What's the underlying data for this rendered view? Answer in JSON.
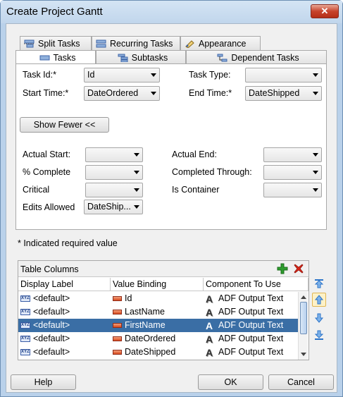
{
  "window": {
    "title": "Create Project Gantt",
    "close_label": "✕"
  },
  "tabs_top": [
    {
      "label": "Split Tasks",
      "icon": "split-tasks-icon"
    },
    {
      "label": "Recurring Tasks",
      "icon": "recurring-tasks-icon"
    },
    {
      "label": "Appearance",
      "icon": "appearance-icon"
    }
  ],
  "tabs_bottom": [
    {
      "label": "Tasks",
      "icon": "tasks-icon",
      "active": true
    },
    {
      "label": "Subtasks",
      "icon": "subtasks-icon"
    },
    {
      "label": "Dependent Tasks",
      "icon": "dependent-tasks-icon"
    }
  ],
  "form": {
    "task_id_label": "Task Id:*",
    "task_id_value": "Id",
    "task_type_label": "Task Type:",
    "task_type_value": "",
    "start_time_label": "Start Time:*",
    "start_time_value": "DateOrdered",
    "end_time_label": "End Time:*",
    "end_time_value": "DateShipped",
    "show_fewer_label": "Show Fewer <<",
    "actual_start_label": "Actual Start:",
    "actual_start_value": "",
    "actual_end_label": "Actual End:",
    "actual_end_value": "",
    "pct_complete_label": "% Complete",
    "pct_complete_value": "",
    "completed_through_label": "Completed Through:",
    "completed_through_value": "",
    "critical_label": "Critical",
    "critical_value": "",
    "is_container_label": "Is Container",
    "is_container_value": "",
    "edits_allowed_label": "Edits Allowed",
    "edits_allowed_value": "DateShip..."
  },
  "required_note": "* Indicated required value",
  "table": {
    "title": "Table Columns",
    "columns": [
      "Display Label",
      "Value Binding",
      "Component To Use"
    ],
    "rows": [
      {
        "label": "<default>",
        "binding": "Id",
        "component": "ADF Output Text",
        "selected": false
      },
      {
        "label": "<default>",
        "binding": "LastName",
        "component": "ADF Output Text",
        "selected": false
      },
      {
        "label": "<default>",
        "binding": "FirstName",
        "component": "ADF Output Text",
        "selected": true
      },
      {
        "label": "<default>",
        "binding": "DateOrdered",
        "component": "ADF Output Text",
        "selected": false
      },
      {
        "label": "<default>",
        "binding": "DateShipped",
        "component": "ADF Output Text",
        "selected": false
      }
    ]
  },
  "buttons": {
    "help": "Help",
    "ok": "OK",
    "cancel": "Cancel"
  },
  "colors": {
    "selection": "#3a6ea5",
    "add_green": "#2e9c2e",
    "delete_red": "#d8261a",
    "side_arrow_blue": "#2c74c9"
  }
}
